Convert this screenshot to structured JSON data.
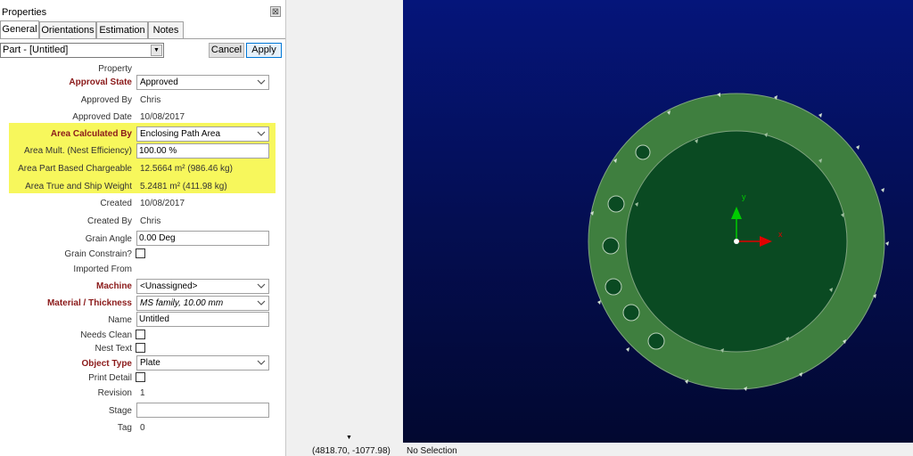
{
  "panel": {
    "title": "Properties",
    "close_glyph": "⊠",
    "tabs": [
      {
        "label": "General",
        "active": true
      },
      {
        "label": "Orientations",
        "active": false
      },
      {
        "label": "Estimation",
        "active": false
      },
      {
        "label": "Notes",
        "active": false
      }
    ],
    "part_selector": "Part - [Untitled]",
    "cancel_label": "Cancel",
    "apply_label": "Apply",
    "header_label": "Property"
  },
  "props": {
    "approval_state": {
      "label": "Approval State",
      "value": "Approved"
    },
    "approved_by": {
      "label": "Approved By",
      "value": "Chris"
    },
    "approved_date": {
      "label": "Approved Date",
      "value": "10/08/2017"
    },
    "area_calculated_by": {
      "label": "Area Calculated By",
      "value": "Enclosing Path Area"
    },
    "area_mult": {
      "label": "Area Mult. (Nest Efficiency)",
      "value": "100.00 %"
    },
    "area_part_based": {
      "label": "Area Part Based Chargeable",
      "value": "12.5664 m² (986.46 kg)"
    },
    "area_true_ship": {
      "label": "Area True and Ship Weight",
      "value": "5.2481 m² (411.98 kg)"
    },
    "created": {
      "label": "Created",
      "value": "10/08/2017"
    },
    "created_by": {
      "label": "Created By",
      "value": "Chris"
    },
    "grain_angle": {
      "label": "Grain Angle",
      "value": "0.00 Deg"
    },
    "grain_constrain": {
      "label": "Grain Constrain?",
      "checked": false
    },
    "imported_from": {
      "label": "Imported From",
      "value": ""
    },
    "machine": {
      "label": "Machine",
      "value": "<Unassigned>"
    },
    "material": {
      "label": "Material / Thickness",
      "value": "MS family, 10.00 mm"
    },
    "name": {
      "label": "Name",
      "value": "Untitled"
    },
    "needs_clean": {
      "label": "Needs Clean",
      "checked": false
    },
    "nest_text": {
      "label": "Nest Text",
      "checked": false
    },
    "object_type": {
      "label": "Object Type",
      "value": "Plate"
    },
    "print_detail": {
      "label": "Print Detail",
      "checked": false
    },
    "revision": {
      "label": "Revision",
      "value": "1"
    },
    "stage": {
      "label": "Stage",
      "value": ""
    },
    "tag": {
      "label": "Tag",
      "value": "0"
    }
  },
  "viewport": {
    "axis_x_label": "x",
    "axis_y_label": "y",
    "ring_color": "#3f7f3f",
    "inner_color": "#0a4a22",
    "x_axis_color": "#e00000",
    "y_axis_color": "#00cc00"
  },
  "status": {
    "coords": "(4818.70, -1077.98)",
    "selection": "No Selection"
  },
  "colors": {
    "highlight": "#f7f75c",
    "required_label": "#8b1a1a",
    "viewport_top": "#05157a",
    "viewport_bottom": "#020830"
  }
}
